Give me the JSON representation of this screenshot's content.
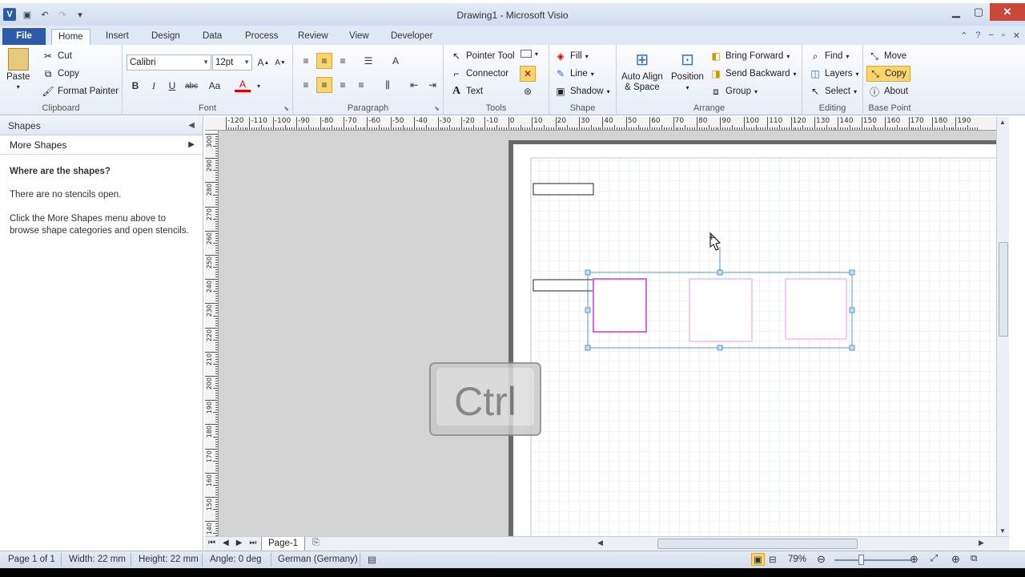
{
  "window": {
    "title": "Drawing1  -  Microsoft Visio",
    "app_icon": "V",
    "controls": [
      "minimize-icon",
      "maximize-icon",
      "close-icon"
    ]
  },
  "tabs": [
    "File",
    "Home",
    "Insert",
    "Design",
    "Data",
    "Process",
    "Review",
    "View",
    "Developer"
  ],
  "ribbon": {
    "clipboard": {
      "paste": "Paste",
      "cut": "Cut",
      "copy": "Copy",
      "format_painter": "Format Painter",
      "label": "Clipboard"
    },
    "font": {
      "family": "Calibri",
      "size": "12pt",
      "label": "Font",
      "bold": "B",
      "italic": "I",
      "underline": "U",
      "strike": "abc",
      "case": "Aa",
      "color": "A"
    },
    "paragraph": {
      "label": "Paragraph"
    },
    "tools": {
      "pointer": "Pointer Tool",
      "connector": "Connector",
      "text": "Text",
      "label": "Tools"
    },
    "shape": {
      "fill": "Fill",
      "line": "Line",
      "shadow": "Shadow",
      "label": "Shape"
    },
    "arrange": {
      "auto_align": "Auto Align",
      "auto_align2": "& Space",
      "position": "Position",
      "bring_forward": "Bring Forward",
      "send_backward": "Send Backward",
      "group": "Group",
      "label": "Arrange"
    },
    "editing": {
      "find": "Find",
      "layers": "Layers",
      "select": "Select",
      "label": "Editing"
    },
    "base_point": {
      "move": "Move",
      "copy": "Copy",
      "about": "About",
      "label": "Base Point"
    }
  },
  "shapes_pane": {
    "title": "Shapes",
    "more_shapes": "More Shapes",
    "heading": "Where are the shapes?",
    "msg1": "There are no stencils open.",
    "msg2": "Click the More Shapes menu above to browse shape categories and open stencils."
  },
  "rulers": {
    "top": [
      "-120",
      "-110",
      "-100",
      "-90",
      "-80",
      "-70",
      "-60",
      "-50",
      "-40",
      "-30",
      "-20",
      "-10",
      "0",
      "10",
      "20",
      "30",
      "40",
      "50",
      "60",
      "70",
      "80",
      "90",
      "100",
      "110",
      "120",
      "130",
      "140",
      "150",
      "160",
      "170",
      "180",
      "190"
    ],
    "left": [
      "300",
      "290",
      "280",
      "270",
      "260",
      "250",
      "240",
      "230",
      "220",
      "210",
      "200",
      "190",
      "180",
      "170",
      "160",
      "150",
      "140"
    ]
  },
  "overlay_key": "Ctrl",
  "page_tab": "Page-1",
  "status": {
    "page": "Page 1 of 1",
    "width": "Width: 22 mm",
    "height": "Height: 22 mm",
    "angle": "Angle: 0 deg",
    "language": "German (Germany)",
    "zoom": "79%"
  },
  "colors": {
    "selected_shape": "#e066e0",
    "shape_outline": "#e59be5",
    "handle": "#3b7fc4",
    "file_tab": "#2a5aa8"
  }
}
